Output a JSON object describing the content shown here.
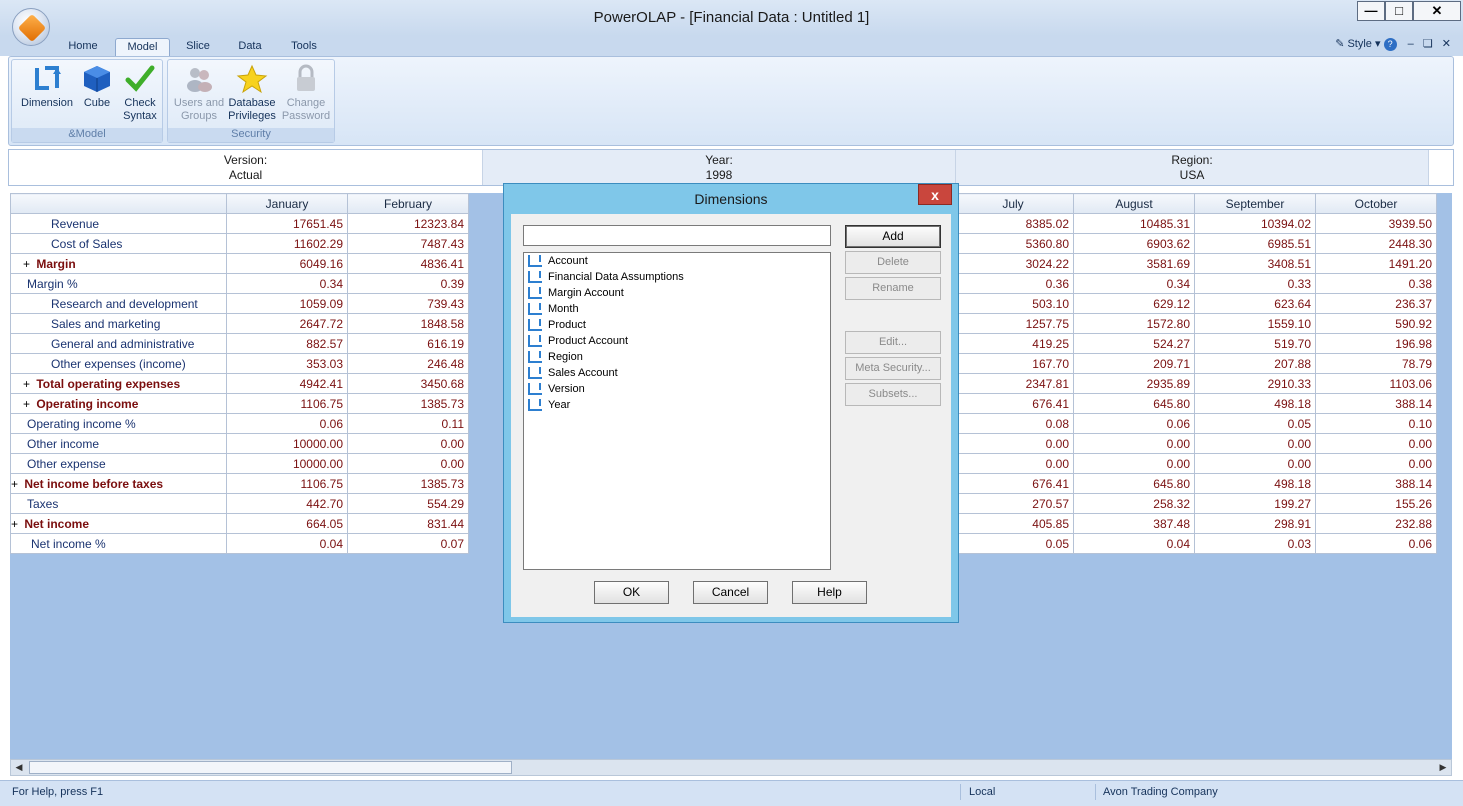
{
  "window": {
    "title": "PowerOLAP - [Financial Data : Untitled 1]"
  },
  "tabs": [
    "Home",
    "Model",
    "Slice",
    "Data",
    "Tools"
  ],
  "active_tab": "Model",
  "top_right": {
    "style_label": "Style"
  },
  "ribbon": {
    "groups": [
      {
        "label": "&Model",
        "buttons": [
          {
            "label1": "Dimension",
            "label2": "",
            "icon": "dimension-icon",
            "enabled": true
          },
          {
            "label1": "Cube",
            "label2": "",
            "icon": "cube-icon",
            "enabled": true
          },
          {
            "label1": "Check",
            "label2": "Syntax",
            "icon": "checkmark-icon",
            "enabled": true
          }
        ]
      },
      {
        "label": "Security",
        "buttons": [
          {
            "label1": "Users and",
            "label2": "Groups",
            "icon": "users-icon",
            "enabled": false
          },
          {
            "label1": "Database",
            "label2": "Privileges",
            "icon": "star-icon",
            "enabled": true
          },
          {
            "label1": "Change",
            "label2": "Password",
            "icon": "lock-icon",
            "enabled": false
          }
        ]
      }
    ]
  },
  "slicers": [
    {
      "name": "Version:",
      "value": "Actual"
    },
    {
      "name": "Year:",
      "value": "1998"
    },
    {
      "name": "Region:",
      "value": "USA"
    }
  ],
  "grid": {
    "columns_left": [
      "January",
      "February"
    ],
    "columns_right": [
      "July",
      "August",
      "September",
      "October"
    ],
    "rows": [
      {
        "label": "Revenue",
        "indent": 2,
        "bold": false,
        "plus": false,
        "left": [
          "17651.45",
          "12323.84"
        ],
        "right": [
          "8385.02",
          "10485.31",
          "10394.02",
          "3939.50"
        ]
      },
      {
        "label": "Cost of Sales",
        "indent": 2,
        "bold": false,
        "plus": false,
        "left": [
          "11602.29",
          "7487.43"
        ],
        "right": [
          "5360.80",
          "6903.62",
          "6985.51",
          "2448.30"
        ]
      },
      {
        "label": "Margin",
        "indent": 1,
        "bold": true,
        "plus": true,
        "left": [
          "6049.16",
          "4836.41"
        ],
        "right": [
          "3024.22",
          "3581.69",
          "3408.51",
          "1491.20"
        ]
      },
      {
        "label": "Margin %",
        "indent": 1,
        "bold": false,
        "plus": false,
        "left": [
          "0.34",
          "0.39"
        ],
        "right": [
          "0.36",
          "0.34",
          "0.33",
          "0.38"
        ]
      },
      {
        "label": "Research and development",
        "indent": 2,
        "bold": false,
        "plus": false,
        "left": [
          "1059.09",
          "739.43"
        ],
        "right": [
          "503.10",
          "629.12",
          "623.64",
          "236.37"
        ]
      },
      {
        "label": "Sales and marketing",
        "indent": 2,
        "bold": false,
        "plus": false,
        "left": [
          "2647.72",
          "1848.58"
        ],
        "right": [
          "1257.75",
          "1572.80",
          "1559.10",
          "590.92"
        ]
      },
      {
        "label": "General and administrative",
        "indent": 2,
        "bold": false,
        "plus": false,
        "left": [
          "882.57",
          "616.19"
        ],
        "right": [
          "419.25",
          "524.27",
          "519.70",
          "196.98"
        ]
      },
      {
        "label": "Other expenses (income)",
        "indent": 2,
        "bold": false,
        "plus": false,
        "left": [
          "353.03",
          "246.48"
        ],
        "right": [
          "167.70",
          "209.71",
          "207.88",
          "78.79"
        ]
      },
      {
        "label": "Total operating expenses",
        "indent": 1,
        "bold": true,
        "plus": true,
        "left": [
          "4942.41",
          "3450.68"
        ],
        "right": [
          "2347.81",
          "2935.89",
          "2910.33",
          "1103.06"
        ]
      },
      {
        "label": "Operating income",
        "indent": 1,
        "bold": true,
        "plus": true,
        "left": [
          "1106.75",
          "1385.73"
        ],
        "right": [
          "676.41",
          "645.80",
          "498.18",
          "388.14"
        ]
      },
      {
        "label": "Operating income %",
        "indent": 1,
        "bold": false,
        "plus": false,
        "left": [
          "0.06",
          "0.11"
        ],
        "right": [
          "0.08",
          "0.06",
          "0.05",
          "0.10"
        ]
      },
      {
        "label": "Other income",
        "indent": 1,
        "bold": false,
        "plus": false,
        "left": [
          "10000.00",
          "0.00"
        ],
        "right": [
          "0.00",
          "0.00",
          "0.00",
          "0.00"
        ]
      },
      {
        "label": "Other expense",
        "indent": 1,
        "bold": false,
        "plus": false,
        "left": [
          "10000.00",
          "0.00"
        ],
        "right": [
          "0.00",
          "0.00",
          "0.00",
          "0.00"
        ]
      },
      {
        "label": "Net income before taxes",
        "indent": 0,
        "bold": true,
        "plus": true,
        "left": [
          "1106.75",
          "1385.73"
        ],
        "right": [
          "676.41",
          "645.80",
          "498.18",
          "388.14"
        ]
      },
      {
        "label": "Taxes",
        "indent": 1,
        "bold": false,
        "plus": false,
        "left": [
          "442.70",
          "554.29"
        ],
        "right": [
          "270.57",
          "258.32",
          "199.27",
          "155.26"
        ]
      },
      {
        "label": "Net income",
        "indent": 0,
        "bold": true,
        "plus": true,
        "left": [
          "664.05",
          "831.44"
        ],
        "right": [
          "405.85",
          "387.48",
          "298.91",
          "232.88"
        ]
      },
      {
        "label": "Net income %",
        "indent": 0,
        "bold": false,
        "plus": false,
        "left": [
          "0.04",
          "0.07"
        ],
        "right": [
          "0.05",
          "0.04",
          "0.03",
          "0.06"
        ]
      }
    ]
  },
  "statusbar": {
    "help": "For Help, press F1",
    "mode": "Local",
    "company": "Avon Trading Company"
  },
  "dialog": {
    "title": "Dimensions",
    "close": "x",
    "search_value": "",
    "items": [
      "Account",
      "Financial Data Assumptions",
      "Margin Account",
      "Month",
      "Product",
      "Product Account",
      "Region",
      "Sales Account",
      "Version",
      "Year"
    ],
    "buttons": {
      "add": "Add",
      "delete": "Delete",
      "rename": "Rename",
      "edit": "Edit...",
      "meta_security": "Meta Security...",
      "subsets": "Subsets..."
    },
    "footer": {
      "ok": "OK",
      "cancel": "Cancel",
      "help": "Help"
    }
  }
}
